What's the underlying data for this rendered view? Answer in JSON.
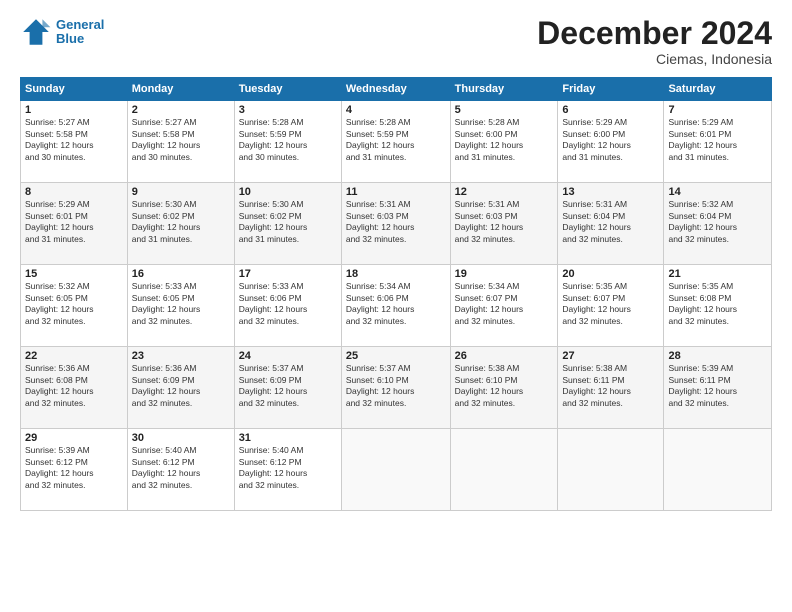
{
  "logo": {
    "line1": "General",
    "line2": "Blue"
  },
  "title": "December 2024",
  "subtitle": "Ciemas, Indonesia",
  "weekdays": [
    "Sunday",
    "Monday",
    "Tuesday",
    "Wednesday",
    "Thursday",
    "Friday",
    "Saturday"
  ],
  "weeks": [
    [
      {
        "day": "1",
        "info": "Sunrise: 5:27 AM\nSunset: 5:58 PM\nDaylight: 12 hours\nand 30 minutes."
      },
      {
        "day": "2",
        "info": "Sunrise: 5:27 AM\nSunset: 5:58 PM\nDaylight: 12 hours\nand 30 minutes."
      },
      {
        "day": "3",
        "info": "Sunrise: 5:28 AM\nSunset: 5:59 PM\nDaylight: 12 hours\nand 30 minutes."
      },
      {
        "day": "4",
        "info": "Sunrise: 5:28 AM\nSunset: 5:59 PM\nDaylight: 12 hours\nand 31 minutes."
      },
      {
        "day": "5",
        "info": "Sunrise: 5:28 AM\nSunset: 6:00 PM\nDaylight: 12 hours\nand 31 minutes."
      },
      {
        "day": "6",
        "info": "Sunrise: 5:29 AM\nSunset: 6:00 PM\nDaylight: 12 hours\nand 31 minutes."
      },
      {
        "day": "7",
        "info": "Sunrise: 5:29 AM\nSunset: 6:01 PM\nDaylight: 12 hours\nand 31 minutes."
      }
    ],
    [
      {
        "day": "8",
        "info": "Sunrise: 5:29 AM\nSunset: 6:01 PM\nDaylight: 12 hours\nand 31 minutes."
      },
      {
        "day": "9",
        "info": "Sunrise: 5:30 AM\nSunset: 6:02 PM\nDaylight: 12 hours\nand 31 minutes."
      },
      {
        "day": "10",
        "info": "Sunrise: 5:30 AM\nSunset: 6:02 PM\nDaylight: 12 hours\nand 31 minutes."
      },
      {
        "day": "11",
        "info": "Sunrise: 5:31 AM\nSunset: 6:03 PM\nDaylight: 12 hours\nand 32 minutes."
      },
      {
        "day": "12",
        "info": "Sunrise: 5:31 AM\nSunset: 6:03 PM\nDaylight: 12 hours\nand 32 minutes."
      },
      {
        "day": "13",
        "info": "Sunrise: 5:31 AM\nSunset: 6:04 PM\nDaylight: 12 hours\nand 32 minutes."
      },
      {
        "day": "14",
        "info": "Sunrise: 5:32 AM\nSunset: 6:04 PM\nDaylight: 12 hours\nand 32 minutes."
      }
    ],
    [
      {
        "day": "15",
        "info": "Sunrise: 5:32 AM\nSunset: 6:05 PM\nDaylight: 12 hours\nand 32 minutes."
      },
      {
        "day": "16",
        "info": "Sunrise: 5:33 AM\nSunset: 6:05 PM\nDaylight: 12 hours\nand 32 minutes."
      },
      {
        "day": "17",
        "info": "Sunrise: 5:33 AM\nSunset: 6:06 PM\nDaylight: 12 hours\nand 32 minutes."
      },
      {
        "day": "18",
        "info": "Sunrise: 5:34 AM\nSunset: 6:06 PM\nDaylight: 12 hours\nand 32 minutes."
      },
      {
        "day": "19",
        "info": "Sunrise: 5:34 AM\nSunset: 6:07 PM\nDaylight: 12 hours\nand 32 minutes."
      },
      {
        "day": "20",
        "info": "Sunrise: 5:35 AM\nSunset: 6:07 PM\nDaylight: 12 hours\nand 32 minutes."
      },
      {
        "day": "21",
        "info": "Sunrise: 5:35 AM\nSunset: 6:08 PM\nDaylight: 12 hours\nand 32 minutes."
      }
    ],
    [
      {
        "day": "22",
        "info": "Sunrise: 5:36 AM\nSunset: 6:08 PM\nDaylight: 12 hours\nand 32 minutes."
      },
      {
        "day": "23",
        "info": "Sunrise: 5:36 AM\nSunset: 6:09 PM\nDaylight: 12 hours\nand 32 minutes."
      },
      {
        "day": "24",
        "info": "Sunrise: 5:37 AM\nSunset: 6:09 PM\nDaylight: 12 hours\nand 32 minutes."
      },
      {
        "day": "25",
        "info": "Sunrise: 5:37 AM\nSunset: 6:10 PM\nDaylight: 12 hours\nand 32 minutes."
      },
      {
        "day": "26",
        "info": "Sunrise: 5:38 AM\nSunset: 6:10 PM\nDaylight: 12 hours\nand 32 minutes."
      },
      {
        "day": "27",
        "info": "Sunrise: 5:38 AM\nSunset: 6:11 PM\nDaylight: 12 hours\nand 32 minutes."
      },
      {
        "day": "28",
        "info": "Sunrise: 5:39 AM\nSunset: 6:11 PM\nDaylight: 12 hours\nand 32 minutes."
      }
    ],
    [
      {
        "day": "29",
        "info": "Sunrise: 5:39 AM\nSunset: 6:12 PM\nDaylight: 12 hours\nand 32 minutes."
      },
      {
        "day": "30",
        "info": "Sunrise: 5:40 AM\nSunset: 6:12 PM\nDaylight: 12 hours\nand 32 minutes."
      },
      {
        "day": "31",
        "info": "Sunrise: 5:40 AM\nSunset: 6:12 PM\nDaylight: 12 hours\nand 32 minutes."
      },
      {
        "day": "",
        "info": ""
      },
      {
        "day": "",
        "info": ""
      },
      {
        "day": "",
        "info": ""
      },
      {
        "day": "",
        "info": ""
      }
    ]
  ]
}
